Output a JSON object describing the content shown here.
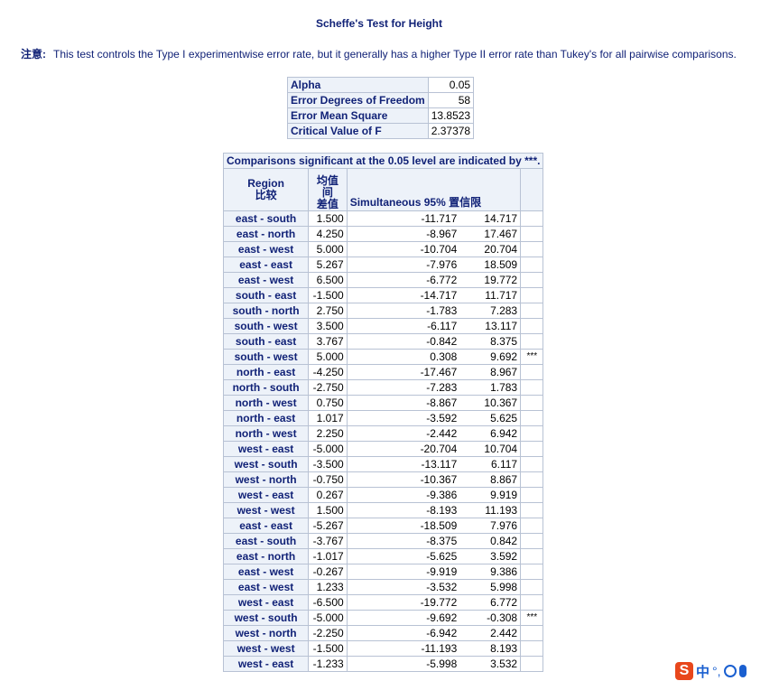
{
  "title": "Scheffe's Test for Height",
  "note": {
    "label": "注意:",
    "text": "This test controls the Type I experimentwise error rate, but it generally has a higher Type II error rate than Tukey's for all pairwise comparisons."
  },
  "params": [
    {
      "label": "Alpha",
      "value": "0.05"
    },
    {
      "label": "Error Degrees of Freedom",
      "value": "58"
    },
    {
      "label": "Error Mean Square",
      "value": "13.8523"
    },
    {
      "label": "Critical Value of F",
      "value": "2.37378"
    }
  ],
  "comparisons": {
    "caption": "Comparisons significant at the 0.05 level are indicated by ***.",
    "headers": {
      "region_line1": "Region",
      "region_line2": "比较",
      "diff_line1": "均值",
      "diff_line2": "间",
      "diff_line3": "差值",
      "ci": "Simultaneous 95% 置信限"
    },
    "rows": [
      {
        "region": "east - south",
        "diff": "1.500",
        "lower": "-11.717",
        "upper": "14.717",
        "sig": ""
      },
      {
        "region": "east - north",
        "diff": "4.250",
        "lower": "-8.967",
        "upper": "17.467",
        "sig": ""
      },
      {
        "region": "east - west",
        "diff": "5.000",
        "lower": "-10.704",
        "upper": "20.704",
        "sig": ""
      },
      {
        "region": "east - east",
        "diff": "5.267",
        "lower": "-7.976",
        "upper": "18.509",
        "sig": ""
      },
      {
        "region": "east - west",
        "diff": "6.500",
        "lower": "-6.772",
        "upper": "19.772",
        "sig": ""
      },
      {
        "region": "south - east",
        "diff": "-1.500",
        "lower": "-14.717",
        "upper": "11.717",
        "sig": ""
      },
      {
        "region": "south - north",
        "diff": "2.750",
        "lower": "-1.783",
        "upper": "7.283",
        "sig": ""
      },
      {
        "region": "south - west",
        "diff": "3.500",
        "lower": "-6.117",
        "upper": "13.117",
        "sig": ""
      },
      {
        "region": "south - east",
        "diff": "3.767",
        "lower": "-0.842",
        "upper": "8.375",
        "sig": ""
      },
      {
        "region": "south - west",
        "diff": "5.000",
        "lower": "0.308",
        "upper": "9.692",
        "sig": "***"
      },
      {
        "region": "north - east",
        "diff": "-4.250",
        "lower": "-17.467",
        "upper": "8.967",
        "sig": ""
      },
      {
        "region": "north - south",
        "diff": "-2.750",
        "lower": "-7.283",
        "upper": "1.783",
        "sig": ""
      },
      {
        "region": "north - west",
        "diff": "0.750",
        "lower": "-8.867",
        "upper": "10.367",
        "sig": ""
      },
      {
        "region": "north - east",
        "diff": "1.017",
        "lower": "-3.592",
        "upper": "5.625",
        "sig": ""
      },
      {
        "region": "north - west",
        "diff": "2.250",
        "lower": "-2.442",
        "upper": "6.942",
        "sig": ""
      },
      {
        "region": "west - east",
        "diff": "-5.000",
        "lower": "-20.704",
        "upper": "10.704",
        "sig": ""
      },
      {
        "region": "west - south",
        "diff": "-3.500",
        "lower": "-13.117",
        "upper": "6.117",
        "sig": ""
      },
      {
        "region": "west - north",
        "diff": "-0.750",
        "lower": "-10.367",
        "upper": "8.867",
        "sig": ""
      },
      {
        "region": "west - east",
        "diff": "0.267",
        "lower": "-9.386",
        "upper": "9.919",
        "sig": ""
      },
      {
        "region": "west - west",
        "diff": "1.500",
        "lower": "-8.193",
        "upper": "11.193",
        "sig": ""
      },
      {
        "region": "east - east",
        "diff": "-5.267",
        "lower": "-18.509",
        "upper": "7.976",
        "sig": ""
      },
      {
        "region": "east - south",
        "diff": "-3.767",
        "lower": "-8.375",
        "upper": "0.842",
        "sig": ""
      },
      {
        "region": "east - north",
        "diff": "-1.017",
        "lower": "-5.625",
        "upper": "3.592",
        "sig": ""
      },
      {
        "region": "east - west",
        "diff": "-0.267",
        "lower": "-9.919",
        "upper": "9.386",
        "sig": ""
      },
      {
        "region": "east - west",
        "diff": "1.233",
        "lower": "-3.532",
        "upper": "5.998",
        "sig": ""
      },
      {
        "region": "west - east",
        "diff": "-6.500",
        "lower": "-19.772",
        "upper": "6.772",
        "sig": ""
      },
      {
        "region": "west - south",
        "diff": "-5.000",
        "lower": "-9.692",
        "upper": "-0.308",
        "sig": "***"
      },
      {
        "region": "west - north",
        "diff": "-2.250",
        "lower": "-6.942",
        "upper": "2.442",
        "sig": ""
      },
      {
        "region": "west - west",
        "diff": "-1.500",
        "lower": "-11.193",
        "upper": "8.193",
        "sig": ""
      },
      {
        "region": "west - east",
        "diff": "-1.233",
        "lower": "-5.998",
        "upper": "3.532",
        "sig": ""
      }
    ]
  },
  "ime_toolbar": {
    "logo_glyph": "S",
    "mode_label": "中",
    "punct_label": "°,",
    "icons": [
      "sogou-logo-icon",
      "emoji-icon",
      "microphone-icon"
    ]
  }
}
